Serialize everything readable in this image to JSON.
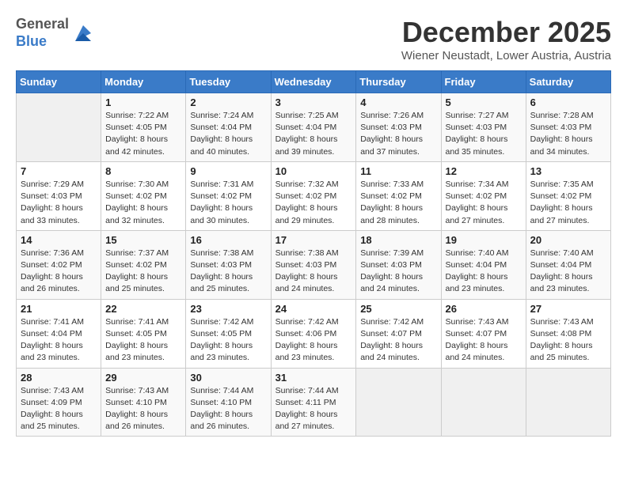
{
  "header": {
    "logo_general": "General",
    "logo_blue": "Blue",
    "month_title": "December 2025",
    "location": "Wiener Neustadt, Lower Austria, Austria"
  },
  "weekdays": [
    "Sunday",
    "Monday",
    "Tuesday",
    "Wednesday",
    "Thursday",
    "Friday",
    "Saturday"
  ],
  "weeks": [
    [
      {
        "day": "",
        "sunrise": "",
        "sunset": "",
        "daylight": ""
      },
      {
        "day": "1",
        "sunrise": "7:22 AM",
        "sunset": "4:05 PM",
        "daylight": "8 hours and 42 minutes."
      },
      {
        "day": "2",
        "sunrise": "7:24 AM",
        "sunset": "4:04 PM",
        "daylight": "8 hours and 40 minutes."
      },
      {
        "day": "3",
        "sunrise": "7:25 AM",
        "sunset": "4:04 PM",
        "daylight": "8 hours and 39 minutes."
      },
      {
        "day": "4",
        "sunrise": "7:26 AM",
        "sunset": "4:03 PM",
        "daylight": "8 hours and 37 minutes."
      },
      {
        "day": "5",
        "sunrise": "7:27 AM",
        "sunset": "4:03 PM",
        "daylight": "8 hours and 35 minutes."
      },
      {
        "day": "6",
        "sunrise": "7:28 AM",
        "sunset": "4:03 PM",
        "daylight": "8 hours and 34 minutes."
      }
    ],
    [
      {
        "day": "7",
        "sunrise": "7:29 AM",
        "sunset": "4:03 PM",
        "daylight": "8 hours and 33 minutes."
      },
      {
        "day": "8",
        "sunrise": "7:30 AM",
        "sunset": "4:02 PM",
        "daylight": "8 hours and 32 minutes."
      },
      {
        "day": "9",
        "sunrise": "7:31 AM",
        "sunset": "4:02 PM",
        "daylight": "8 hours and 30 minutes."
      },
      {
        "day": "10",
        "sunrise": "7:32 AM",
        "sunset": "4:02 PM",
        "daylight": "8 hours and 29 minutes."
      },
      {
        "day": "11",
        "sunrise": "7:33 AM",
        "sunset": "4:02 PM",
        "daylight": "8 hours and 28 minutes."
      },
      {
        "day": "12",
        "sunrise": "7:34 AM",
        "sunset": "4:02 PM",
        "daylight": "8 hours and 27 minutes."
      },
      {
        "day": "13",
        "sunrise": "7:35 AM",
        "sunset": "4:02 PM",
        "daylight": "8 hours and 27 minutes."
      }
    ],
    [
      {
        "day": "14",
        "sunrise": "7:36 AM",
        "sunset": "4:02 PM",
        "daylight": "8 hours and 26 minutes."
      },
      {
        "day": "15",
        "sunrise": "7:37 AM",
        "sunset": "4:02 PM",
        "daylight": "8 hours and 25 minutes."
      },
      {
        "day": "16",
        "sunrise": "7:38 AM",
        "sunset": "4:03 PM",
        "daylight": "8 hours and 25 minutes."
      },
      {
        "day": "17",
        "sunrise": "7:38 AM",
        "sunset": "4:03 PM",
        "daylight": "8 hours and 24 minutes."
      },
      {
        "day": "18",
        "sunrise": "7:39 AM",
        "sunset": "4:03 PM",
        "daylight": "8 hours and 24 minutes."
      },
      {
        "day": "19",
        "sunrise": "7:40 AM",
        "sunset": "4:04 PM",
        "daylight": "8 hours and 23 minutes."
      },
      {
        "day": "20",
        "sunrise": "7:40 AM",
        "sunset": "4:04 PM",
        "daylight": "8 hours and 23 minutes."
      }
    ],
    [
      {
        "day": "21",
        "sunrise": "7:41 AM",
        "sunset": "4:04 PM",
        "daylight": "8 hours and 23 minutes."
      },
      {
        "day": "22",
        "sunrise": "7:41 AM",
        "sunset": "4:05 PM",
        "daylight": "8 hours and 23 minutes."
      },
      {
        "day": "23",
        "sunrise": "7:42 AM",
        "sunset": "4:05 PM",
        "daylight": "8 hours and 23 minutes."
      },
      {
        "day": "24",
        "sunrise": "7:42 AM",
        "sunset": "4:06 PM",
        "daylight": "8 hours and 23 minutes."
      },
      {
        "day": "25",
        "sunrise": "7:42 AM",
        "sunset": "4:07 PM",
        "daylight": "8 hours and 24 minutes."
      },
      {
        "day": "26",
        "sunrise": "7:43 AM",
        "sunset": "4:07 PM",
        "daylight": "8 hours and 24 minutes."
      },
      {
        "day": "27",
        "sunrise": "7:43 AM",
        "sunset": "4:08 PM",
        "daylight": "8 hours and 25 minutes."
      }
    ],
    [
      {
        "day": "28",
        "sunrise": "7:43 AM",
        "sunset": "4:09 PM",
        "daylight": "8 hours and 25 minutes."
      },
      {
        "day": "29",
        "sunrise": "7:43 AM",
        "sunset": "4:10 PM",
        "daylight": "8 hours and 26 minutes."
      },
      {
        "day": "30",
        "sunrise": "7:44 AM",
        "sunset": "4:10 PM",
        "daylight": "8 hours and 26 minutes."
      },
      {
        "day": "31",
        "sunrise": "7:44 AM",
        "sunset": "4:11 PM",
        "daylight": "8 hours and 27 minutes."
      },
      {
        "day": "",
        "sunrise": "",
        "sunset": "",
        "daylight": ""
      },
      {
        "day": "",
        "sunrise": "",
        "sunset": "",
        "daylight": ""
      },
      {
        "day": "",
        "sunrise": "",
        "sunset": "",
        "daylight": ""
      }
    ]
  ]
}
